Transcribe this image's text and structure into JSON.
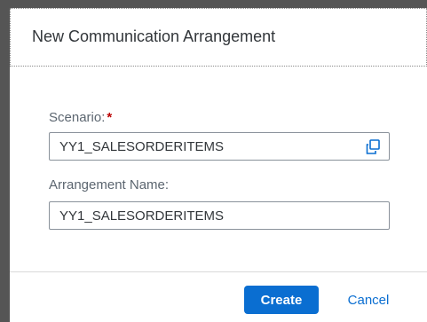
{
  "dialog": {
    "title": "New Communication Arrangement"
  },
  "form": {
    "scenario": {
      "label": "Scenario:",
      "required_marker": "*",
      "value": "YY1_SALESORDERITEMS",
      "icon": "value-help-icon"
    },
    "arrangement_name": {
      "label": "Arrangement Name:",
      "value": "YY1_SALESORDERITEMS"
    }
  },
  "footer": {
    "create_label": "Create",
    "cancel_label": "Cancel"
  },
  "colors": {
    "accent": "#0a6ed1",
    "required": "#bb0000",
    "text": "#32363a",
    "label": "#5c6670"
  }
}
